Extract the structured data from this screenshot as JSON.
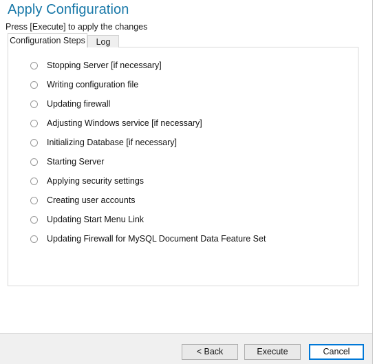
{
  "header": {
    "title": "Apply Configuration",
    "subtitle": "Press [Execute] to apply the changes"
  },
  "tabs": [
    {
      "label": "Configuration Steps",
      "active": true
    },
    {
      "label": "Log",
      "active": false
    }
  ],
  "steps": [
    {
      "label": "Stopping Server [if necessary]",
      "state": "pending"
    },
    {
      "label": "Writing configuration file",
      "state": "pending"
    },
    {
      "label": "Updating firewall",
      "state": "pending"
    },
    {
      "label": "Adjusting Windows service [if necessary]",
      "state": "pending"
    },
    {
      "label": "Initializing Database [if necessary]",
      "state": "pending"
    },
    {
      "label": "Starting Server",
      "state": "pending"
    },
    {
      "label": "Applying security settings",
      "state": "pending"
    },
    {
      "label": "Creating user accounts",
      "state": "pending"
    },
    {
      "label": "Updating Start Menu Link",
      "state": "pending"
    },
    {
      "label": "Updating Firewall for MySQL Document Data Feature Set",
      "state": "pending"
    }
  ],
  "footer": {
    "back_label": "< Back",
    "execute_label": "Execute",
    "cancel_label": "Cancel"
  },
  "colors": {
    "title_blue": "#1878a8",
    "focus_blue": "#0078d7",
    "footer_bg": "#f0f0f0",
    "panel_border": "#d8d8d8"
  }
}
